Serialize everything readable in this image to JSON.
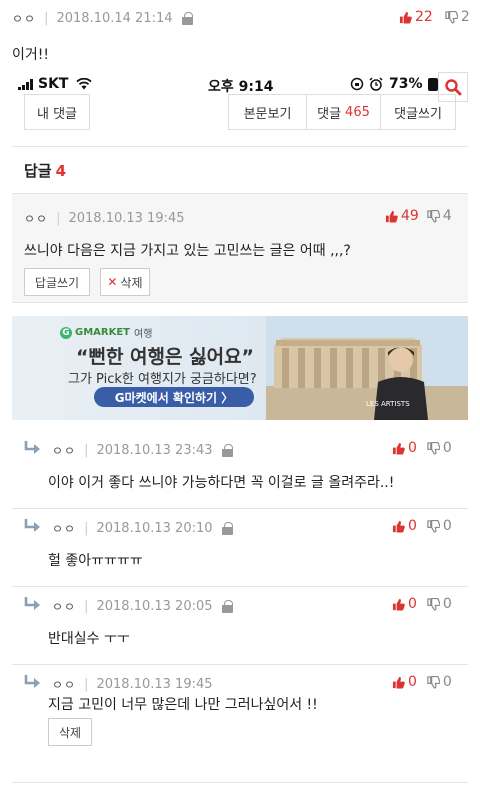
{
  "post": {
    "author": "ㅇㅇ",
    "datetime": "2018.10.14 21:14",
    "upvotes": "22",
    "downvotes": "2",
    "body": "이거!!"
  },
  "status_bar": {
    "carrier": "SKT",
    "time": "오후 9:14",
    "battery": "73%"
  },
  "toolbar": {
    "my_comments": "내 댓글",
    "view_post": "본문보기",
    "comments_label": "댓글",
    "comments_count": "465",
    "write_comment": "댓글쓰기"
  },
  "replies_section": {
    "label": "답글",
    "count": "4"
  },
  "main_comment": {
    "author": "ㅇㅇ",
    "datetime": "2018.10.13 19:45",
    "upvotes": "49",
    "downvotes": "4",
    "text": "쓰니야 다음은 지금 가지고 있는 고민쓰는 글은 어때 ,,,?",
    "reply_button": "답글쓰기",
    "delete_button": "삭제"
  },
  "ad": {
    "logo_brand": "GMARKET",
    "logo_tag": "여행",
    "headline": "“뻔한 여행은 싫어요”",
    "subline": "그가 Pick한 여행지가 궁금하다면?",
    "cta": "G마켓에서 확인하기 〉",
    "shirt_text": "LES ARTISTS"
  },
  "replies": [
    {
      "author": "ㅇㅇ",
      "datetime": "2018.10.13 23:43",
      "upvotes": "0",
      "downvotes": "0",
      "text": "이야 이거 좋다 쓰니야 가능하다면 꼭 이걸로 글 올려주라..!"
    },
    {
      "author": "ㅇㅇ",
      "datetime": "2018.10.13 20:10",
      "upvotes": "0",
      "downvotes": "0",
      "text": "헐 좋아ㅠㅠㅠㅠ"
    },
    {
      "author": "ㅇㅇ",
      "datetime": "2018.10.13 20:05",
      "upvotes": "0",
      "downvotes": "0",
      "text": "반대실수 ㅜㅜ"
    },
    {
      "author": "ㅇㅇ",
      "datetime": "2018.10.13 19:45",
      "upvotes": "0",
      "downvotes": "0",
      "text": "지금 고민이 너무 많은데 나만 그러나싶어서 !!",
      "delete_button": "삭제"
    }
  ],
  "colors": {
    "accent_red": "#d33333",
    "cta_blue": "#3a5da8",
    "comment_bg": "#f6f6f6"
  }
}
